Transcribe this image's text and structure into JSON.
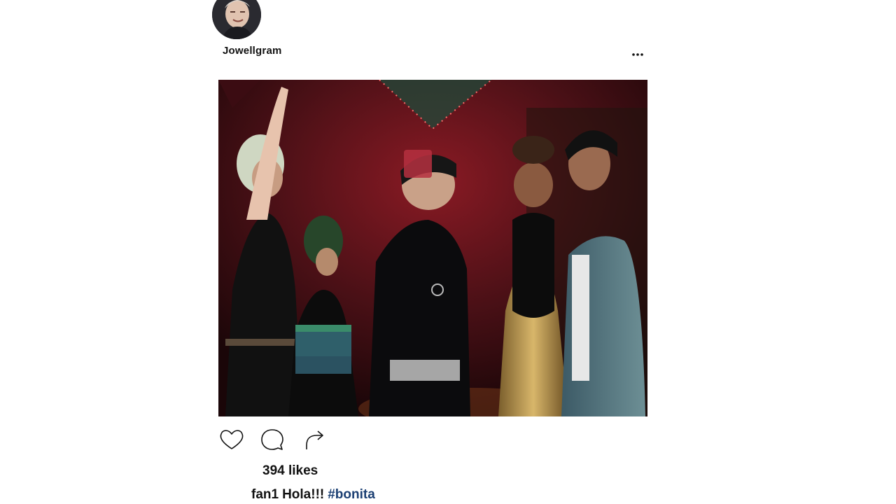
{
  "post": {
    "username": "Jowellgram",
    "more_icon": "ellipsis-icon",
    "photo_alt": "nightclub-scene",
    "actions": {
      "like_icon": "heart-icon",
      "comment_icon": "comment-icon",
      "share_icon": "share-arrow-icon"
    },
    "likes_text": "394 likes",
    "caption": {
      "user": "fan1",
      "text": "Hola!!!",
      "hashtag": "#bonita"
    }
  },
  "colors": {
    "hashtag": "#1b3f73",
    "text": "#111111",
    "background": "#ffffff"
  }
}
